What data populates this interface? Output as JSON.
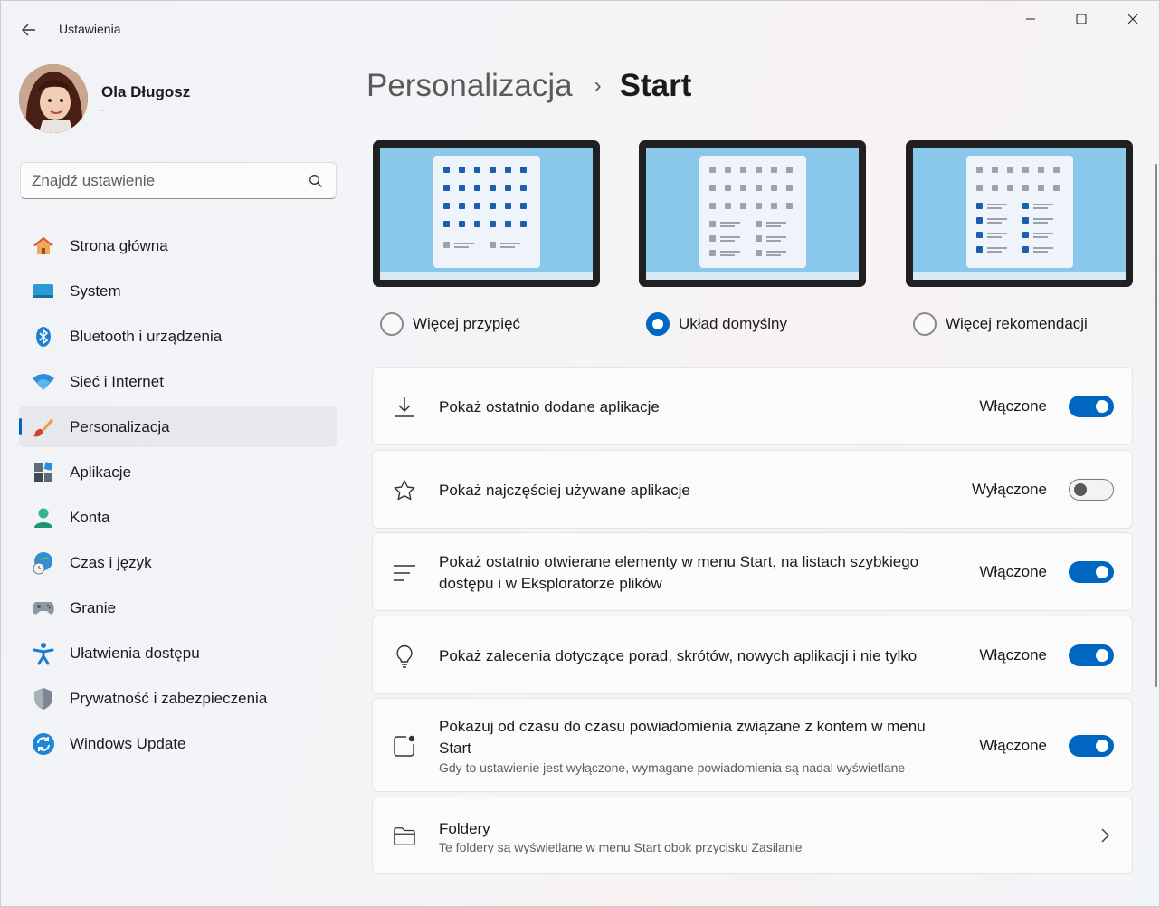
{
  "window": {
    "title": "Ustawienia",
    "controls": [
      "minimize-icon",
      "maximize-icon",
      "close-icon"
    ]
  },
  "profile": {
    "name": "Ola Długosz",
    "subtitle": "."
  },
  "search": {
    "placeholder": "Znajdź ustawienie",
    "value": ""
  },
  "sidebar": {
    "items": [
      {
        "label": "Strona główna",
        "icon": "home-icon",
        "active": false
      },
      {
        "label": "System",
        "icon": "monitor-icon",
        "active": false
      },
      {
        "label": "Bluetooth i urządzenia",
        "icon": "bluetooth-icon",
        "active": false
      },
      {
        "label": "Sieć i Internet",
        "icon": "wifi-icon",
        "active": false
      },
      {
        "label": "Personalizacja",
        "icon": "paintbrush-icon",
        "active": true
      },
      {
        "label": "Aplikacje",
        "icon": "apps-icon",
        "active": false
      },
      {
        "label": "Konta",
        "icon": "person-icon",
        "active": false
      },
      {
        "label": "Czas i język",
        "icon": "globe-clock-icon",
        "active": false
      },
      {
        "label": "Granie",
        "icon": "gamepad-icon",
        "active": false
      },
      {
        "label": "Ułatwienia dostępu",
        "icon": "accessibility-icon",
        "active": false
      },
      {
        "label": "Prywatność i zabezpieczenia",
        "icon": "shield-icon",
        "active": false
      },
      {
        "label": "Windows Update",
        "icon": "update-icon",
        "active": false
      }
    ]
  },
  "breadcrumb": {
    "parent": "Personalizacja",
    "separator": "›",
    "current": "Start"
  },
  "layouts": {
    "options": [
      {
        "label": "Więcej przypięć",
        "checked": false,
        "preview": "more-pins"
      },
      {
        "label": "Układ domyślny",
        "checked": true,
        "preview": "default"
      },
      {
        "label": "Więcej rekomendacji",
        "checked": false,
        "preview": "more-recommendations"
      }
    ]
  },
  "settings": {
    "recent_apps": {
      "title": "Pokaż ostatnio dodane aplikacje",
      "state": "Włączone",
      "on": true,
      "icon": "download-icon"
    },
    "most_used": {
      "title": "Pokaż najczęściej używane aplikacje",
      "state": "Wyłączone",
      "on": false,
      "icon": "star-icon"
    },
    "recent_items": {
      "title": "Pokaż ostatnio otwierane elementy w menu Start, na listach szybkiego dostępu i w Eksploratorze plików",
      "state": "Włączone",
      "on": true,
      "icon": "list-icon"
    },
    "tips": {
      "title": "Pokaż zalecenia dotyczące porad, skrótów, nowych aplikacji i nie tylko",
      "state": "Włączone",
      "on": true,
      "icon": "lightbulb-icon"
    },
    "account_notifications": {
      "title": "Pokazuj od czasu do czasu powiadomienia związane z kontem w menu Start",
      "description": "Gdy to ustawienie jest wyłączone, wymagane powiadomienia są nadal wyświetlane",
      "state": "Włączone",
      "on": true,
      "icon": "notification-badge-icon"
    },
    "folders": {
      "title": "Foldery",
      "description": "Te foldery są wyświetlane w menu Start obok przycisku Zasilanie",
      "icon": "folder-icon"
    }
  },
  "colors": {
    "accent": "#0067c0",
    "preview_screen": "#89c8ea",
    "preview_bezel": "#202020"
  }
}
